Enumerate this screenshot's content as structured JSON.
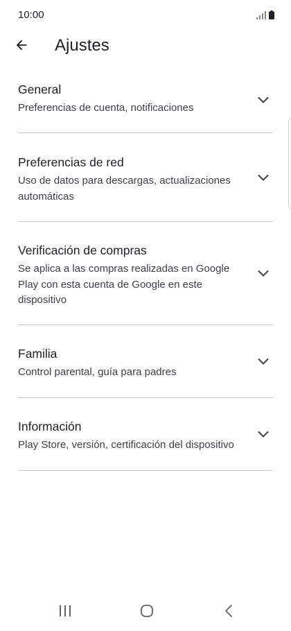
{
  "status_bar": {
    "time": "10:00",
    "icons": [
      "signal-icon",
      "battery-icon"
    ]
  },
  "app_bar": {
    "back_icon": "arrow-left-icon",
    "title": "Ajustes"
  },
  "settings": [
    {
      "title": "General",
      "subtitle": "Preferencias de cuenta, notificaciones",
      "icon": "chevron-down-icon"
    },
    {
      "title": "Preferencias de red",
      "subtitle": "Uso de datos para descargas, actualizaciones automáticas",
      "icon": "chevron-down-icon"
    },
    {
      "title": "Verificación de compras",
      "subtitle": "Se aplica a las compras realizadas en Google Play con esta cuenta de Google en este dispositivo",
      "icon": "chevron-down-icon"
    },
    {
      "title": "Familia",
      "subtitle": "Control parental, guía para padres",
      "icon": "chevron-down-icon"
    },
    {
      "title": "Información",
      "subtitle": "Play Store, versión, certificación del dispositivo",
      "icon": "chevron-down-icon"
    }
  ],
  "nav_bar": {
    "icons": [
      "recent-apps-icon",
      "home-icon",
      "back-nav-icon"
    ]
  },
  "colors": {
    "text_primary": "#202124",
    "text_secondary": "#3c4043",
    "divider": "#c7c7c7",
    "background": "#ffffff"
  }
}
